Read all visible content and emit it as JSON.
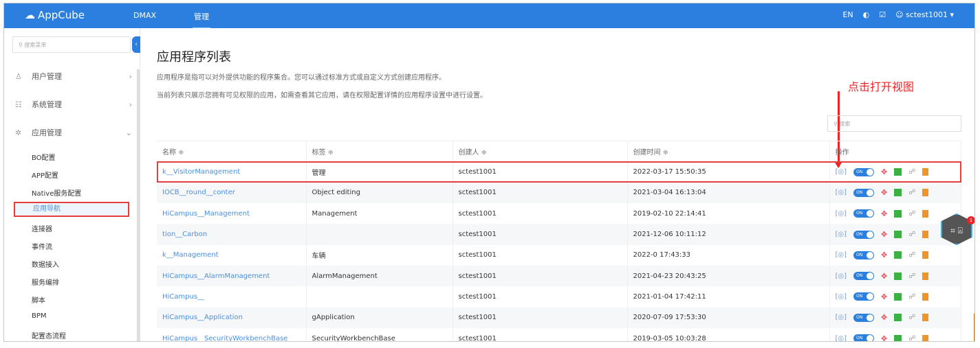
{
  "header": {
    "logo": "AppCube",
    "nav": [
      "DMAX",
      "管理"
    ],
    "lang": "EN",
    "user": "sctest1001"
  },
  "sidebar": {
    "search_placeholder": "搜索菜单",
    "groups": [
      {
        "label": "用户管理",
        "icon": "user-icon"
      },
      {
        "label": "系统管理",
        "icon": "settings-icon"
      },
      {
        "label": "应用管理",
        "icon": "app-icon"
      }
    ],
    "sub_items": [
      "BO配置",
      "APP配置",
      "Native服务配置",
      "应用导航",
      "连接器",
      "事件流",
      "数据接入",
      "服务编排",
      "脚本",
      "BPM",
      "配置态流程"
    ],
    "selected": "应用导航"
  },
  "main": {
    "title": "应用程序列表",
    "desc1": "应用程序是指可以对外提供功能的程序集合。您可以通过标准方式或自定义方式创建应用程序。",
    "desc2": "当前列表只展示您拥有可见权限的应用，如需查看其它应用，请在权限配置详情的应用程序设置中进行设置。",
    "search_placeholder": "搜索",
    "annotation": "点击打开视图",
    "columns": [
      "名称 ≑",
      "标签 ≑",
      "创建人 ≑",
      "创建时间 ≑",
      "操作"
    ],
    "toggle_label": "ON",
    "rows": [
      {
        "name": "k__VisitorManagement",
        "label": "管理",
        "creator": "sctest1001",
        "time": "2022-03-17 15:50:35"
      },
      {
        "name": "IOCB__round__conter",
        "label": "Object editing",
        "creator": "sctest1001",
        "time": "2021-03-04 16:13:04"
      },
      {
        "name": "HiCampus__Management",
        "label": "Management",
        "creator": "sctest1001",
        "time": "2019-02-10 22:14:41"
      },
      {
        "name": "tion__Carbon",
        "label": "",
        "creator": "sctest1001",
        "time": "2021-12-06 10:11:12"
      },
      {
        "name": "k__Management",
        "label": "车辆",
        "creator": "sctest1001",
        "time": "2022-0 17:43:33"
      },
      {
        "name": "HiCampus__AlarmManagement",
        "label": "AlarmManagement",
        "creator": "sctest1001",
        "time": "2021-04-23 20:43:25"
      },
      {
        "name": "HiCampus__",
        "label": "",
        "creator": "sctest1001",
        "time": "2021-01-04 17:42:11"
      },
      {
        "name": "HiCampus__Application",
        "label": "gApplication",
        "creator": "sctest1001",
        "time": "2020-07-09 17:53:30"
      },
      {
        "name": "HiCampus__SecurityWorkbenchBase",
        "label": "SecurityWorkbenchBase",
        "creator": "sctest1001",
        "time": "2019-03-05 10:03:28"
      }
    ]
  },
  "colors": {
    "primary": "#2a7fdf",
    "highlight": "#e43d3d",
    "annotation": "#e8262a"
  }
}
